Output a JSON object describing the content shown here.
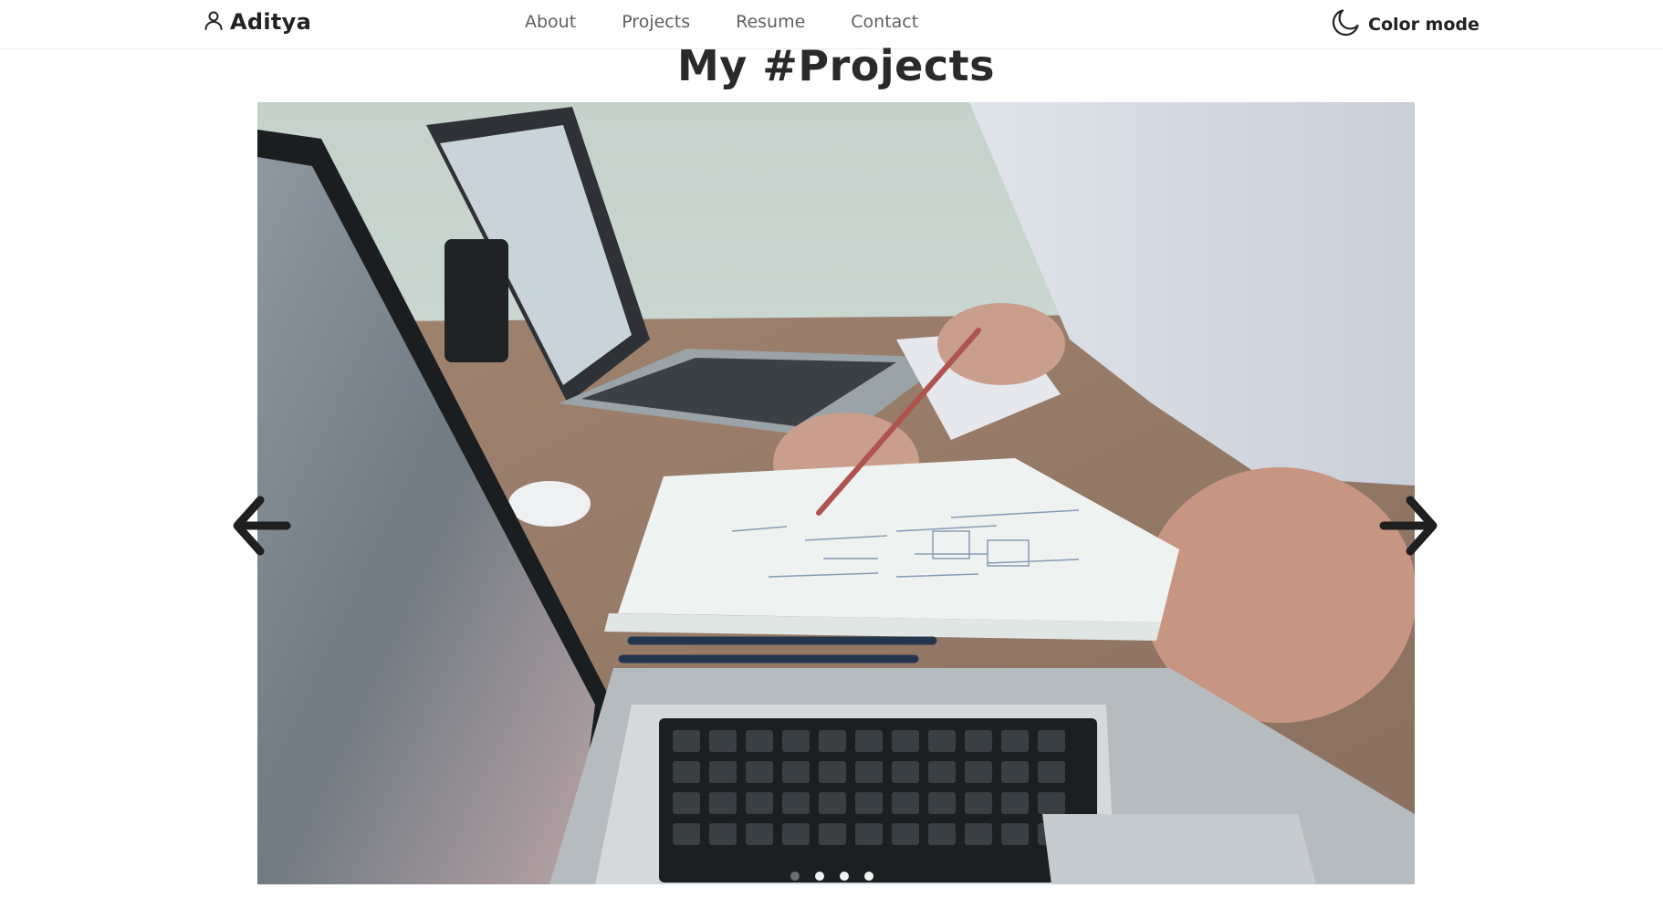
{
  "brand": {
    "name": "Aditya",
    "icon": "user-icon"
  },
  "nav": {
    "links": [
      {
        "label": "About"
      },
      {
        "label": "Projects"
      },
      {
        "label": "Resume"
      },
      {
        "label": "Contact"
      }
    ]
  },
  "color_mode": {
    "label": "Color mode",
    "icon": "moon-icon"
  },
  "page": {
    "title": "My #Projects"
  },
  "carousel": {
    "image_description": "Photo of people working at a desk with laptops, pens and paper sketches",
    "slide_count": 4,
    "active_slide": 1,
    "prev_icon": "arrow-left-icon",
    "next_icon": "arrow-right-icon"
  },
  "colors": {
    "text_dark": "#222222",
    "nav_text": "#5f5f5f",
    "background": "#ffffff"
  }
}
